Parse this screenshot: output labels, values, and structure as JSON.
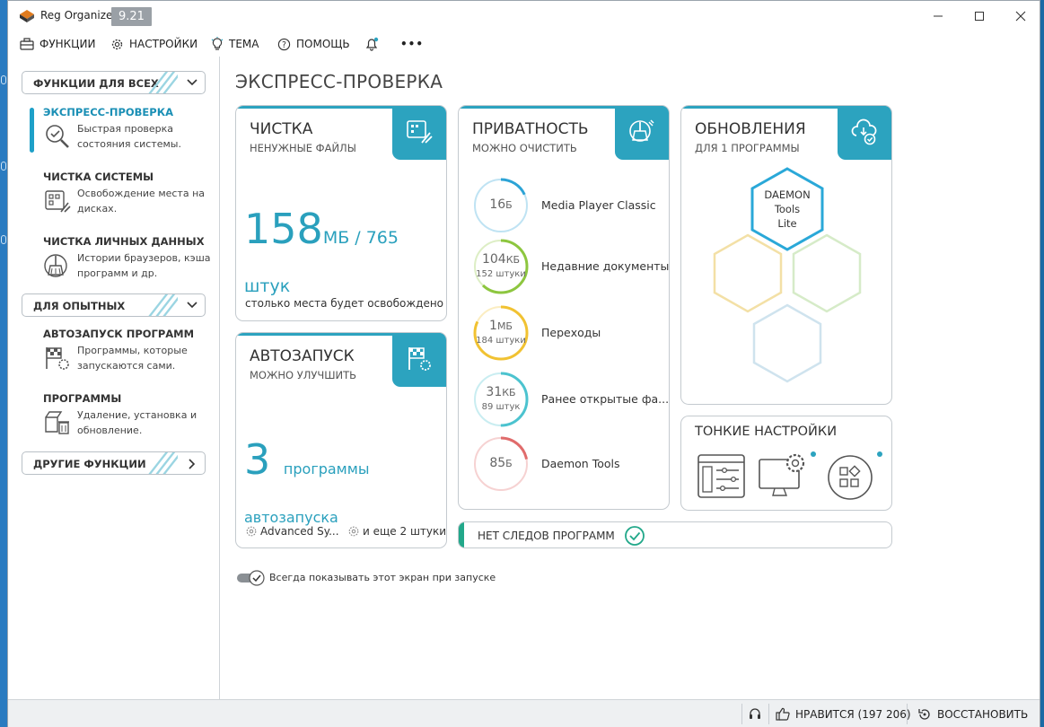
{
  "app": {
    "title": "Reg Organizer",
    "version": "9.21"
  },
  "menu": {
    "functions": "ФУНКЦИИ",
    "settings": "НАСТРОЙКИ",
    "theme": "ТЕМА",
    "help": "ПОМОЩЬ",
    "more": "•••"
  },
  "sidebar": {
    "group_all": "ФУНКЦИИ ДЛЯ ВСЕХ",
    "group_advanced": "ДЛЯ ОПЫТНЫХ",
    "group_other": "ДРУГИЕ ФУНКЦИИ",
    "items": [
      {
        "title": "ЭКСПРЕСС-ПРОВЕРКА",
        "desc": "Быстрая проверка состояния системы.",
        "active": true
      },
      {
        "title": "ЧИСТКА СИСТЕМЫ",
        "desc": "Освобождение места на дисках."
      },
      {
        "title": "ЧИСТКА ЛИЧНЫХ ДАННЫХ",
        "desc": "Истории браузеров, кэша программ и др."
      },
      {
        "title": "АВТОЗАПУСК ПРОГРАММ",
        "desc": "Программы, которые запускаются сами."
      },
      {
        "title": "ПРОГРАММЫ",
        "desc": "Удаление, установка и обновление."
      }
    ]
  },
  "main": {
    "title": "ЭКСПРЕСС-ПРОВЕРКА",
    "cleanup": {
      "title": "ЧИСТКА",
      "subtitle": "НЕНУЖНЫЕ ФАЙЛЫ",
      "value": "158",
      "unit": "МБ / 765 штук",
      "footer": "столько места будет освобождено"
    },
    "autorun": {
      "title": "АВТОЗАПУСК",
      "subtitle": "МОЖНО УЛУЧШИТЬ",
      "value": "3",
      "unit": "программы автозапуска",
      "footer_app": "Advanced Sy...",
      "footer_more": "и еще 2 штуки"
    },
    "privacy": {
      "title": "ПРИВАТНОСТЬ",
      "subtitle": "МОЖНО ОЧИСТИТЬ",
      "items": [
        {
          "value": "16",
          "unit": "Б",
          "count": "",
          "name": "Media Player Classic",
          "color": "#2ca3d6",
          "fraction": 0.18
        },
        {
          "value": "104",
          "unit": "КБ",
          "count": "152 штуки",
          "name": "Недавние документы",
          "color": "#8dc63f",
          "fraction": 0.62
        },
        {
          "value": "1",
          "unit": "МБ",
          "count": "184 штуки",
          "name": "Переходы",
          "color": "#f1c232",
          "fraction": 0.82
        },
        {
          "value": "31",
          "unit": "КБ",
          "count": "89 штук",
          "name": "Ранее открытые фа...",
          "color": "#4cc3cf",
          "fraction": 0.5
        },
        {
          "value": "85",
          "unit": "Б",
          "count": "",
          "name": "Daemon Tools",
          "color": "#e06b6b",
          "fraction": 0.22
        }
      ]
    },
    "updates": {
      "title": "ОБНОВЛЕНИЯ",
      "subtitle": "ДЛЯ 1 ПРОГРАММЫ",
      "program_line1": "DAEMON",
      "program_line2": "Tools",
      "program_line3": "Lite"
    },
    "tweaks": {
      "title": "ТОНКИЕ НАСТРОЙКИ"
    },
    "no_traces": "НЕТ СЛЕДОВ ПРОГРАММ",
    "startup_toggle_label": "Всегда показывать этот экран при запуске"
  },
  "status": {
    "likes": "НРАВИТСЯ (197 206)",
    "restore": "ВОССТАНОВИТЬ"
  },
  "colors": {
    "accent": "#2ca3bf",
    "accent_text": "#1a8fb5"
  }
}
